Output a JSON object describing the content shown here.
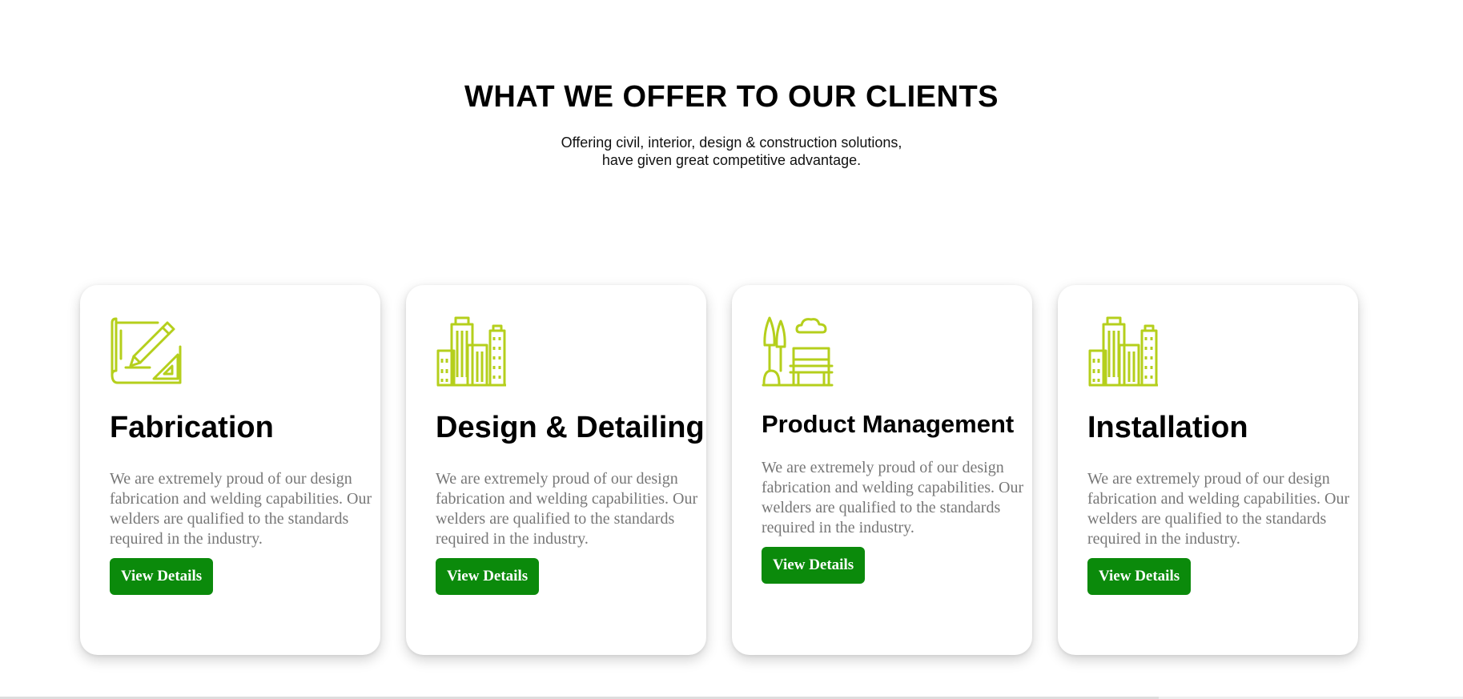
{
  "header": {
    "title": "WHAT WE OFFER TO OUR CLIENTS",
    "subtitle_line1": "Offering civil, interior, design & construction solutions,",
    "subtitle_line2": "have given great competitive advantage."
  },
  "colors": {
    "icon": "#b5cf1c",
    "button": "#0b8a0b",
    "body_text": "#777777"
  },
  "cards": [
    {
      "icon": "drafting-pencil-icon",
      "title": "Fabrication",
      "text": "We are extremely proud of our design fabrication and welding capabilities. Our welders are qualified to the standards required in the industry.",
      "button": "View Details"
    },
    {
      "icon": "city-buildings-icon",
      "title": "Design & Detailing",
      "text": "We are extremely proud of our design fabrication and welding capabilities. Our welders are qualified to the standards required in the industry.",
      "button": "View Details"
    },
    {
      "icon": "park-bench-icon",
      "title": "Product Management",
      "text": "We are extremely proud of our design fabrication and welding capabilities. Our welders are qualified to the standards required in the industry.",
      "button": "View Details"
    },
    {
      "icon": "city-buildings-icon",
      "title": "Installation",
      "text": "We are extremely proud of our design fabrication and welding capabilities. Our welders are qualified to the standards required in the industry.",
      "button": "View Details"
    }
  ]
}
